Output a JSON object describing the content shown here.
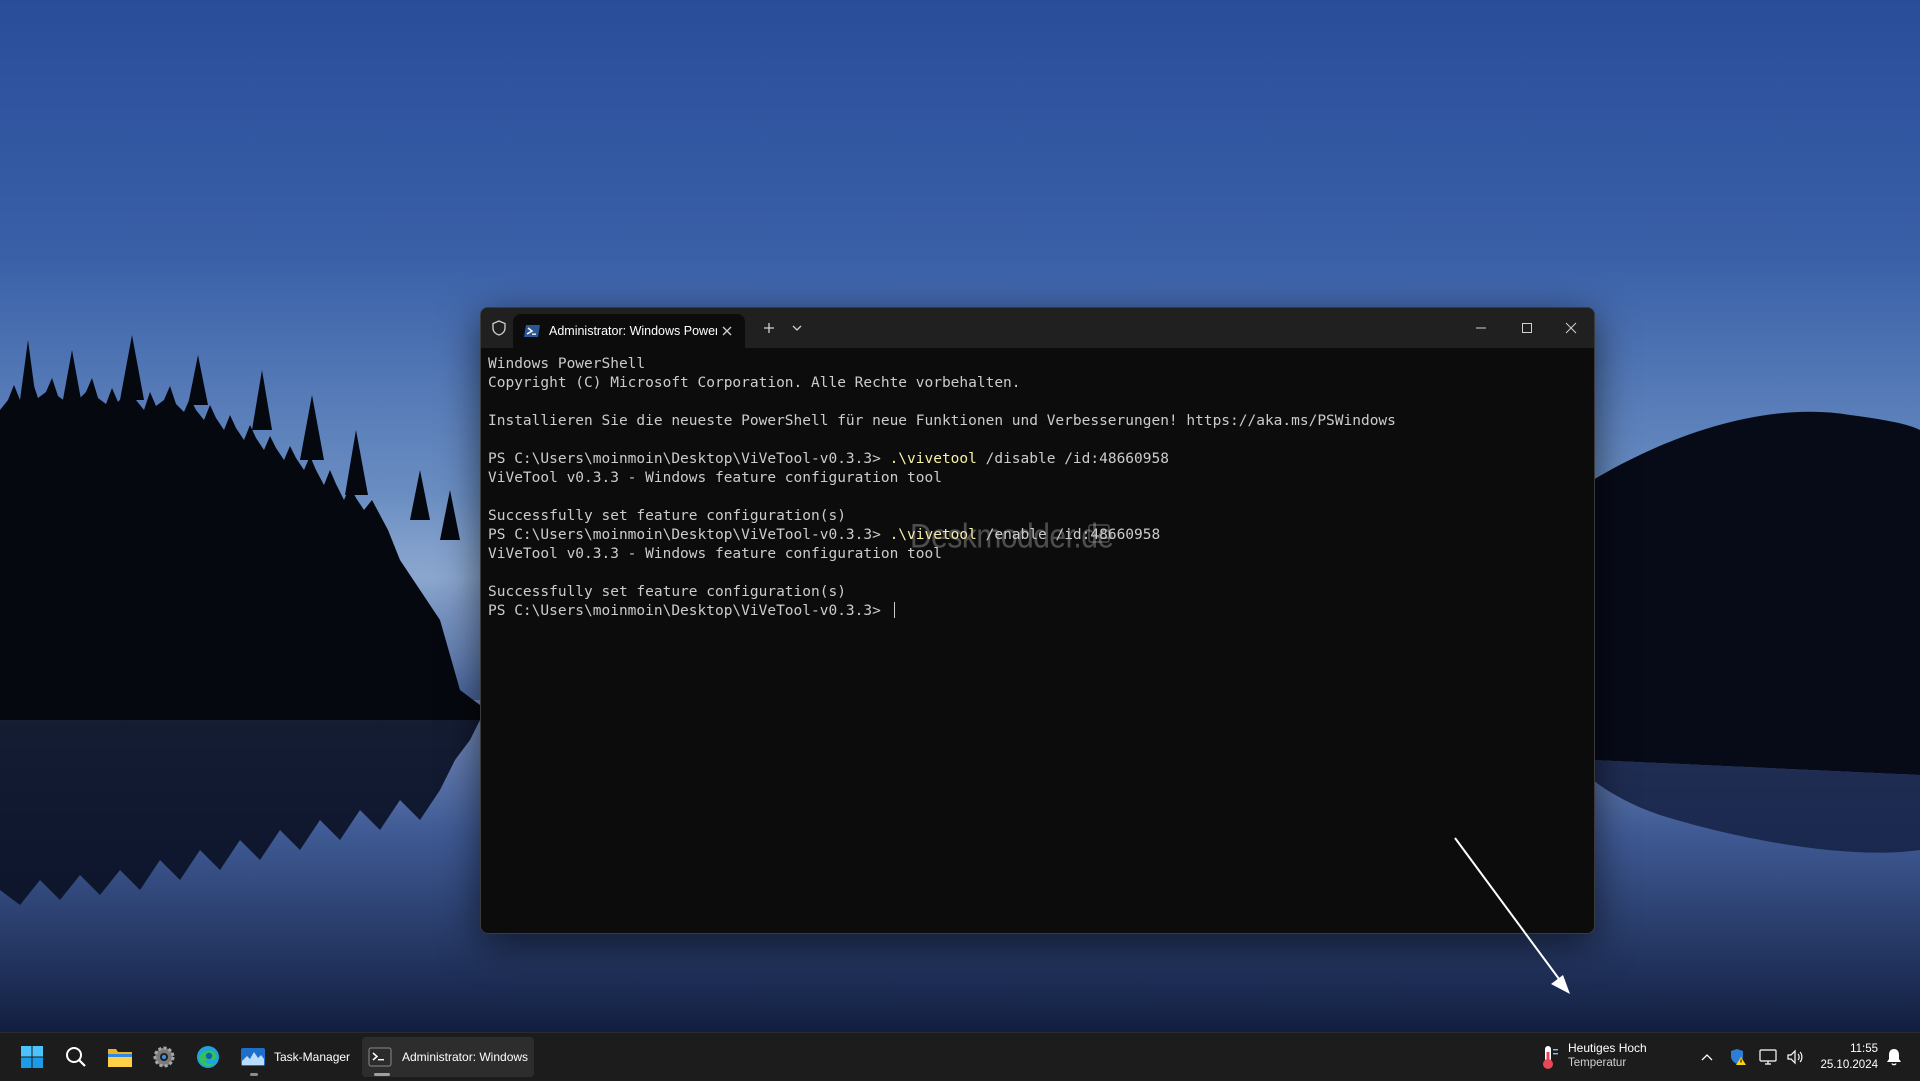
{
  "terminal": {
    "tab_title": "Administrator: Windows PowerShell",
    "lines": [
      {
        "text": "Windows PowerShell"
      },
      {
        "text": "Copyright (C) Microsoft Corporation. Alle Rechte vorbehalten."
      },
      {
        "text": ""
      },
      {
        "text": "Installieren Sie die neueste PowerShell für neue Funktionen und Verbesserungen! https://aka.ms/PSWindows"
      },
      {
        "text": ""
      },
      {
        "prompt": "PS C:\\Users\\moinmoin\\Desktop\\ViVeTool-v0.3.3> ",
        "cmd": ".\\vivetool",
        "args": " /disable /id:48660958"
      },
      {
        "text": "ViVeTool v0.3.3 - Windows feature configuration tool"
      },
      {
        "text": ""
      },
      {
        "text": "Successfully set feature configuration(s)"
      },
      {
        "prompt": "PS C:\\Users\\moinmoin\\Desktop\\ViVeTool-v0.3.3> ",
        "cmd": ".\\vivetool",
        "args": " /enable /id:48660958"
      },
      {
        "text": "ViVeTool v0.3.3 - Windows feature configuration tool"
      },
      {
        "text": ""
      },
      {
        "text": "Successfully set feature configuration(s)"
      },
      {
        "prompt": "PS C:\\Users\\moinmoin\\Desktop\\ViVeTool-v0.3.3> ",
        "cursor": true
      }
    ],
    "watermark": "Deskmodder.de"
  },
  "taskbar": {
    "apps": [
      {
        "name": "start-button",
        "icon": "windows-logo-icon"
      },
      {
        "name": "search-button",
        "icon": "search-icon"
      },
      {
        "name": "file-explorer-button",
        "icon": "folder-icon"
      },
      {
        "name": "settings-button",
        "icon": "gear-icon"
      },
      {
        "name": "edge-button",
        "icon": "edge-icon"
      }
    ],
    "task_manager_label": "Task-Manager",
    "terminal_label": "Administrator: Windows PowerShell",
    "weather_title": "Heutiges Hoch",
    "weather_sub": "Temperatur",
    "time": "11:55",
    "date": "25.10.2024"
  },
  "colors": {
    "terminal_bg": "#0c0c0c",
    "command_yellow": "#f9f1a5",
    "taskbar_bg": "#1c1c1c",
    "accent_blue": "#0078d4"
  }
}
